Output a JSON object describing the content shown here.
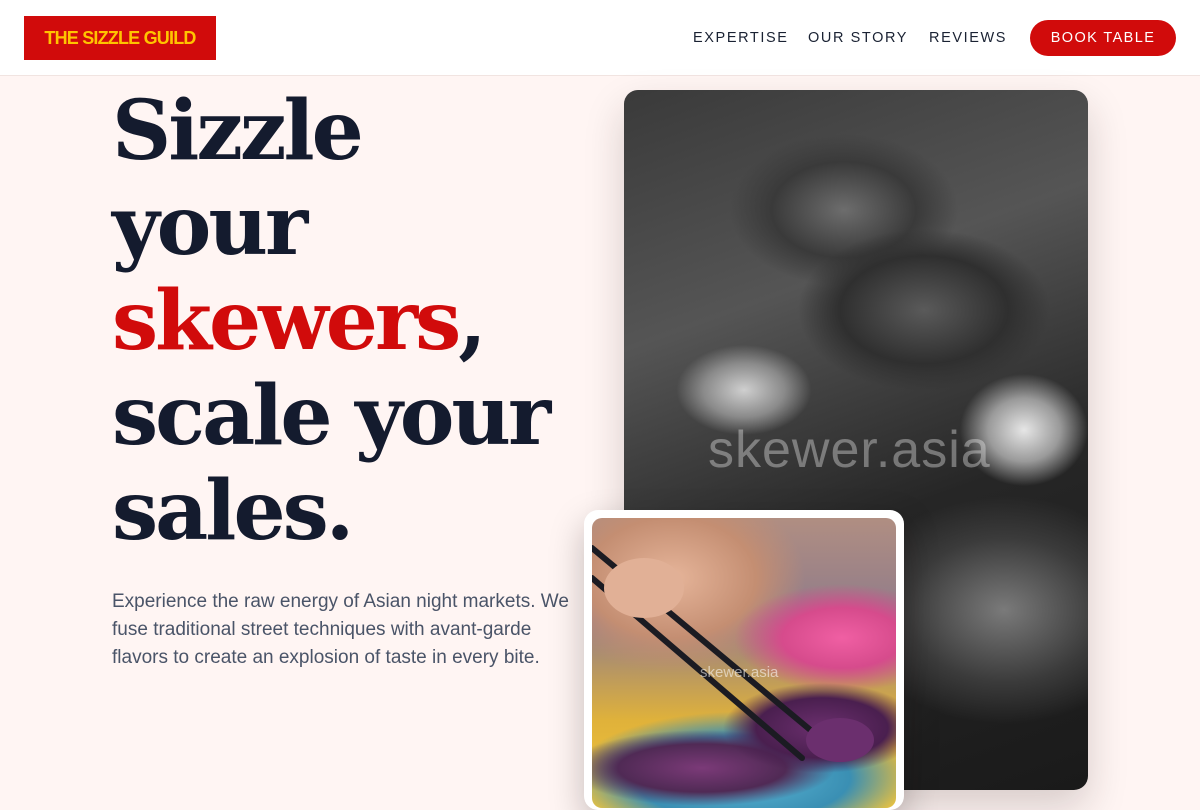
{
  "brand": {
    "logo_text": "THE SIZZLE GUILD"
  },
  "nav": {
    "links": [
      "EXPERTISE",
      "OUR STORY",
      "REVIEWS"
    ],
    "cta": "BOOK TABLE"
  },
  "hero": {
    "title_line1": "Sizzle",
    "title_line2": "your",
    "title_accent": "skewers",
    "title_comma": ",",
    "title_line4": "scale your",
    "title_line5": "sales.",
    "description": "Experience the raw energy of Asian night markets. We fuse traditional street techniques with avant-garde flavors to create an explosion of taste in every bite."
  },
  "images": {
    "main_watermark": "skewer.asia",
    "inset_watermark": "skewer.asia"
  },
  "colors": {
    "accent": "#d10b0b",
    "logo_text": "#ffc400",
    "heading": "#141b2e",
    "background": "#fff5f3"
  }
}
